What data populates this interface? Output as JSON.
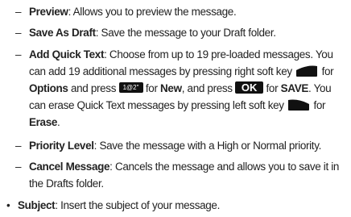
{
  "items": [
    {
      "label": "Preview",
      "desc": ": Allows you to preview the message."
    },
    {
      "label": "Save As Draft",
      "desc": ": Save the message to your Draft folder."
    },
    {
      "label": "Add Quick Text",
      "desc": ": Choose from up to 19 pre-loaded messages. You",
      "line2_text": "can add 19 additional messages by pressing right soft key",
      "line2_for": "for",
      "options": "Options",
      "and_press": "and press",
      "for2": "for",
      "new": "New",
      "and_press2": ", and press",
      "ok_key": "OK",
      "for3": "for",
      "save": "SAVE",
      "you": ". You",
      "line4_text": "can erase Quick Text messages by pressing left soft key",
      "for4": "for",
      "erase": "Erase",
      "period": ".",
      "one_key": "1@2\""
    },
    {
      "label": "Priority Level",
      "desc": ": Save the message with a High or Normal priority."
    },
    {
      "label": "Cancel Message",
      "desc": ": Cancels the message and allows you to save it in",
      "line2": "the Drafts folder."
    }
  ],
  "subject": {
    "label": "Subject",
    "desc": ": Insert the subject of your message."
  },
  "dash_char": "–",
  "bullet_char": "•"
}
